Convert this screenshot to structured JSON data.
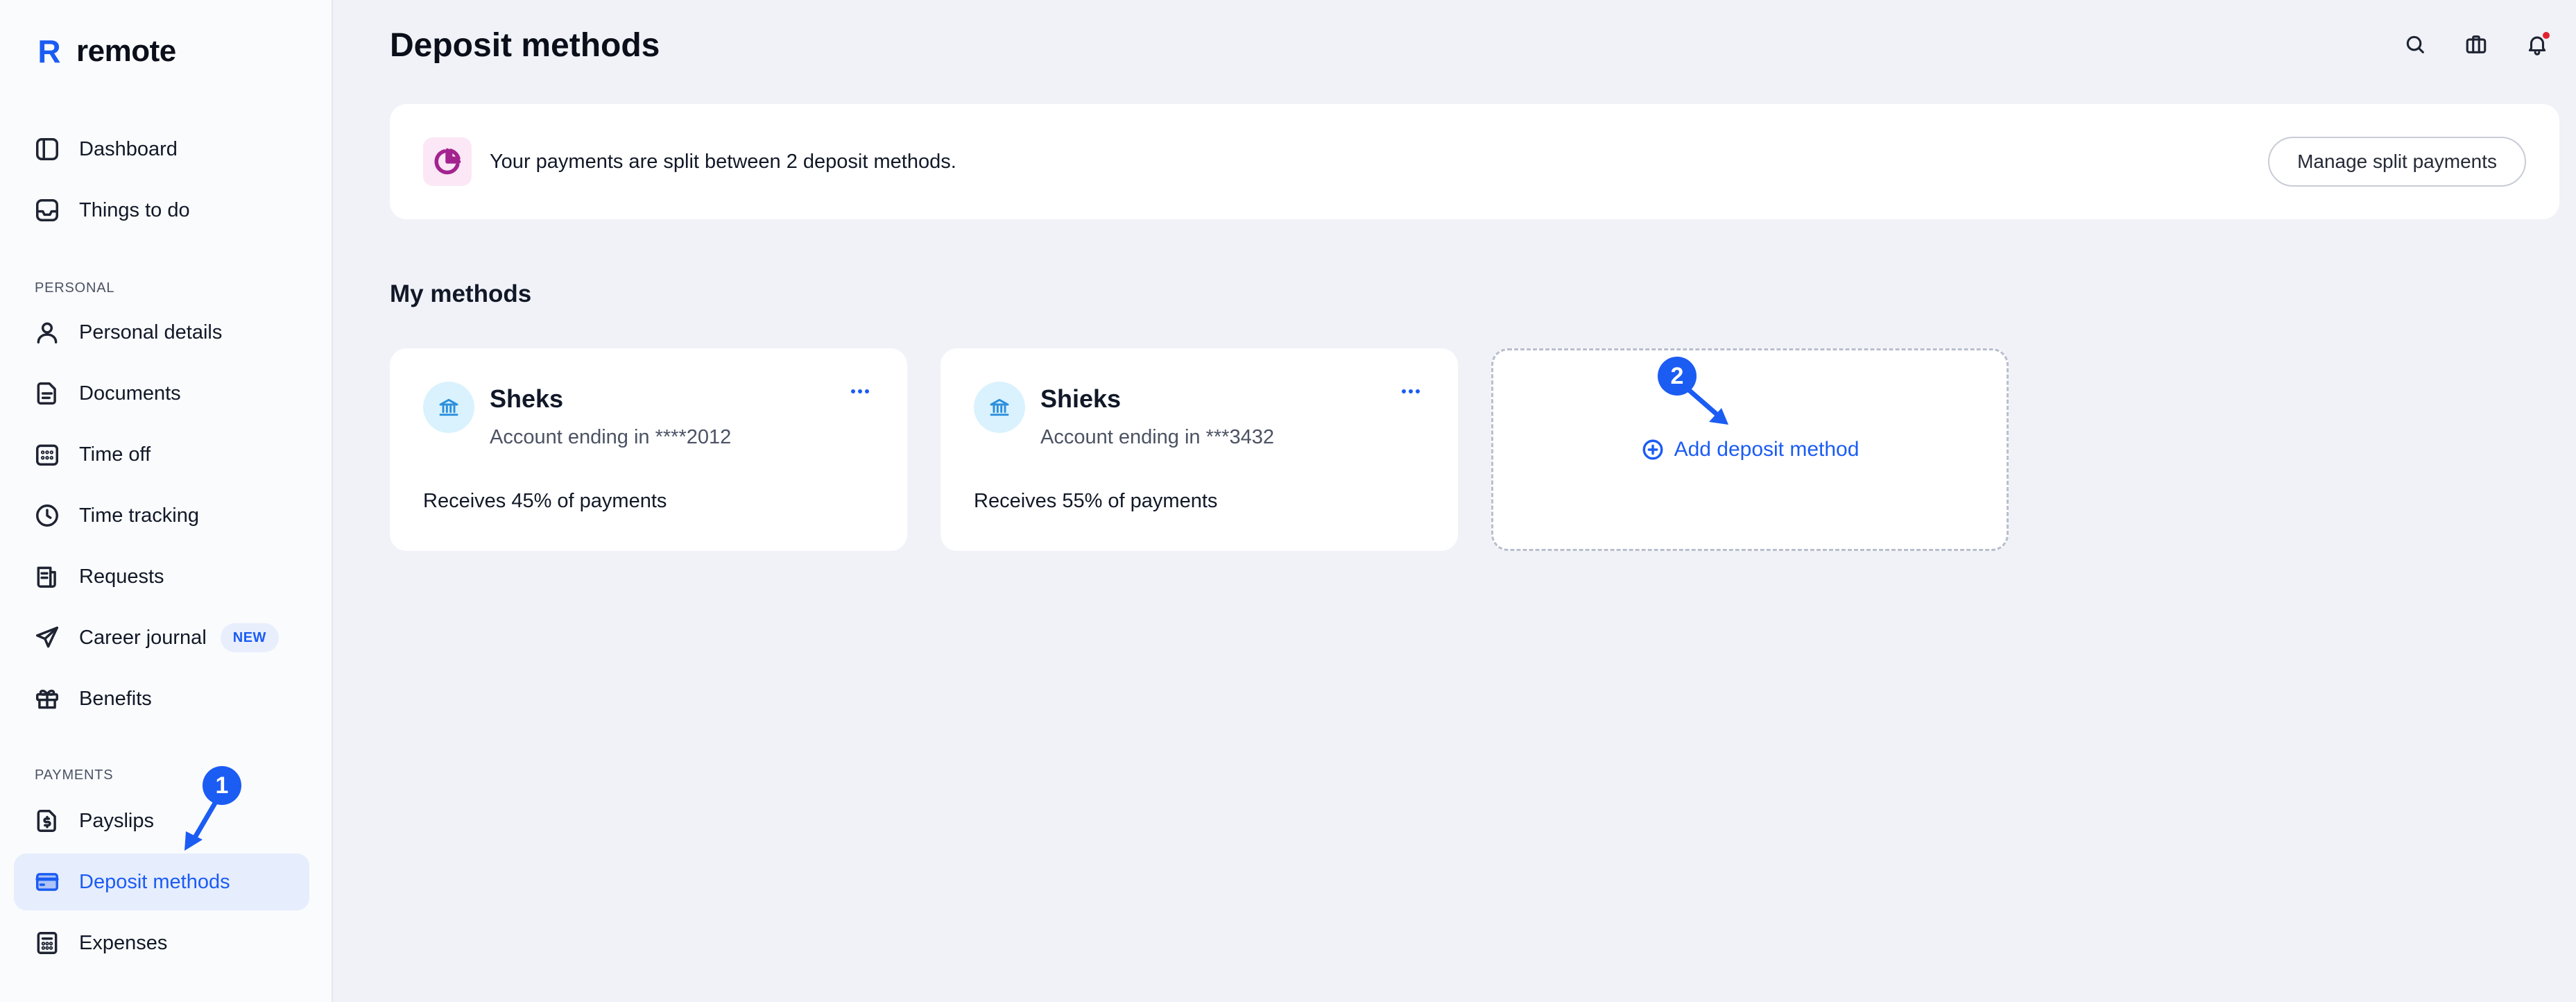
{
  "app": {
    "logo_text": "remote",
    "logo_mark": "R"
  },
  "sidebar": {
    "top_items": [
      {
        "label": "Dashboard",
        "icon": "sidebar-panel-icon"
      },
      {
        "label": "Things to do",
        "icon": "inbox-icon"
      }
    ],
    "personal_section_label": "PERSONAL",
    "personal_items": [
      {
        "label": "Personal details",
        "icon": "user-icon"
      },
      {
        "label": "Documents",
        "icon": "document-icon"
      },
      {
        "label": "Time off",
        "icon": "calendar-icon"
      },
      {
        "label": "Time tracking",
        "icon": "clock-icon"
      },
      {
        "label": "Requests",
        "icon": "requests-icon"
      },
      {
        "label": "Career journal",
        "icon": "paper-plane-icon",
        "badge": "NEW"
      },
      {
        "label": "Benefits",
        "icon": "gift-icon"
      }
    ],
    "payments_section_label": "PAYMENTS",
    "payments_items": [
      {
        "label": "Payslips",
        "icon": "payslip-icon"
      },
      {
        "label": "Deposit methods",
        "icon": "card-icon",
        "active": true
      },
      {
        "label": "Expenses",
        "icon": "receipt-icon"
      }
    ]
  },
  "header": {
    "title": "Deposit methods",
    "icons": [
      "search-icon",
      "briefcase-icon",
      "bell-icon"
    ]
  },
  "split_banner": {
    "text": "Your payments are split between 2 deposit methods.",
    "button_label": "Manage split payments",
    "icon": "pie-chart-icon"
  },
  "methods": {
    "section_title": "My methods",
    "cards": [
      {
        "name": "Sheks",
        "account": "Account ending in ****2012",
        "share": "Receives 45% of payments"
      },
      {
        "name": "Shieks",
        "account": "Account ending in ***3432",
        "share": "Receives 55% of payments"
      }
    ],
    "add_label": "Add deposit method"
  },
  "annotations": {
    "step1": "1",
    "step2": "2"
  },
  "colors": {
    "accent": "#1b5cf3",
    "background": "#f1f2f7",
    "sidebar_bg": "#fafbfd",
    "notification": "#e2232e"
  }
}
